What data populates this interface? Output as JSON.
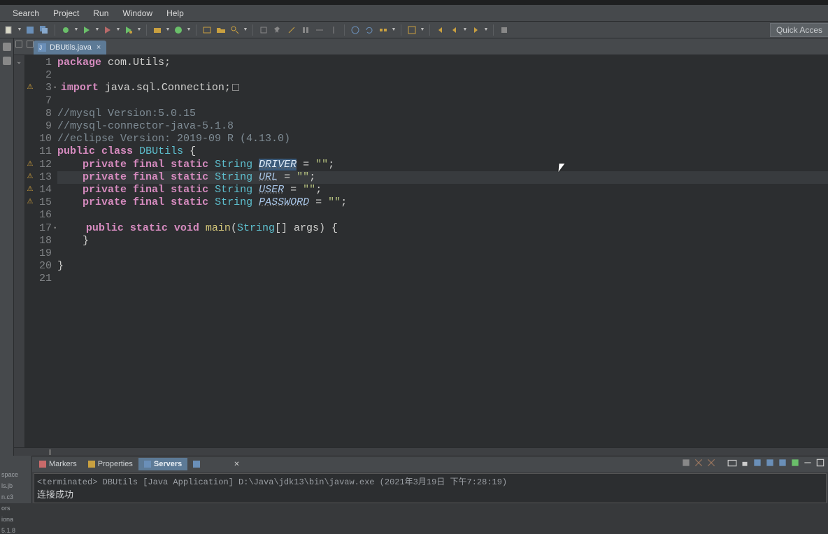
{
  "menubar": [
    "Search",
    "Project",
    "Run",
    "Window",
    "Help"
  ],
  "quick_access": "Quick Acces",
  "tab": {
    "name": "DBUtils.java"
  },
  "code_lines": [
    {
      "n": 1,
      "marker": "",
      "segs": [
        [
          "kw-pink",
          "package"
        ],
        [
          "plain",
          " "
        ],
        [
          "plain",
          "com.Utils;"
        ]
      ]
    },
    {
      "n": 2,
      "marker": "",
      "segs": []
    },
    {
      "n": 3,
      "marker": "warn",
      "bullet": true,
      "segs": [
        [
          "kw-pink",
          "import"
        ],
        [
          "plain",
          " "
        ],
        [
          "plain",
          "java.sql.Connection;"
        ],
        [
          "foldbox",
          ""
        ]
      ]
    },
    {
      "n": 7,
      "marker": "",
      "segs": []
    },
    {
      "n": 8,
      "marker": "",
      "segs": [
        [
          "comment",
          "//mysql Version:5.0.15"
        ]
      ]
    },
    {
      "n": 9,
      "marker": "",
      "segs": [
        [
          "comment",
          "//mysql-connector-java-5.1.8"
        ]
      ]
    },
    {
      "n": 10,
      "marker": "",
      "segs": [
        [
          "comment",
          "//eclipse Version: 2019-09 R (4.13.0)"
        ]
      ]
    },
    {
      "n": 11,
      "marker": "",
      "segs": [
        [
          "kw-pink",
          "public"
        ],
        [
          "plain",
          " "
        ],
        [
          "kw-pink",
          "class"
        ],
        [
          "plain",
          " "
        ],
        [
          "classname",
          "DBUtils"
        ],
        [
          "plain",
          " {"
        ]
      ]
    },
    {
      "n": 12,
      "marker": "warn",
      "segs": [
        [
          "plain",
          "    "
        ],
        [
          "kw-pink",
          "private"
        ],
        [
          "plain",
          " "
        ],
        [
          "kw-pink",
          "final"
        ],
        [
          "plain",
          " "
        ],
        [
          "kw-pink",
          "static"
        ],
        [
          "plain",
          " "
        ],
        [
          "type",
          "String"
        ],
        [
          "plain",
          " "
        ],
        [
          "field sel",
          "DRIVER"
        ],
        [
          "plain",
          " = "
        ],
        [
          "str",
          "\"\""
        ],
        [
          "plain",
          ";"
        ]
      ]
    },
    {
      "n": 13,
      "marker": "warn",
      "hl": true,
      "segs": [
        [
          "plain",
          "    "
        ],
        [
          "kw-pink",
          "private"
        ],
        [
          "plain",
          " "
        ],
        [
          "kw-pink",
          "final"
        ],
        [
          "plain",
          " "
        ],
        [
          "kw-pink",
          "static"
        ],
        [
          "plain",
          " "
        ],
        [
          "type",
          "String"
        ],
        [
          "plain",
          " "
        ],
        [
          "field",
          "URL"
        ],
        [
          "plain",
          " = "
        ],
        [
          "str",
          "\"\""
        ],
        [
          "plain",
          ";"
        ]
      ]
    },
    {
      "n": 14,
      "marker": "warn",
      "segs": [
        [
          "plain",
          "    "
        ],
        [
          "kw-pink",
          "private"
        ],
        [
          "plain",
          " "
        ],
        [
          "kw-pink",
          "final"
        ],
        [
          "plain",
          " "
        ],
        [
          "kw-pink",
          "static"
        ],
        [
          "plain",
          " "
        ],
        [
          "type",
          "String"
        ],
        [
          "plain",
          " "
        ],
        [
          "field",
          "USER"
        ],
        [
          "plain",
          " = "
        ],
        [
          "str",
          "\"\""
        ],
        [
          "plain",
          ";"
        ]
      ]
    },
    {
      "n": 15,
      "marker": "warn",
      "segs": [
        [
          "plain",
          "    "
        ],
        [
          "kw-pink",
          "private"
        ],
        [
          "plain",
          " "
        ],
        [
          "kw-pink",
          "final"
        ],
        [
          "plain",
          " "
        ],
        [
          "kw-pink",
          "static"
        ],
        [
          "plain",
          " "
        ],
        [
          "type",
          "String"
        ],
        [
          "plain",
          " "
        ],
        [
          "field",
          "PASSWORD"
        ],
        [
          "plain",
          " = "
        ],
        [
          "str",
          "\"\""
        ],
        [
          "plain",
          ";"
        ]
      ]
    },
    {
      "n": 16,
      "marker": "",
      "segs": []
    },
    {
      "n": 17,
      "marker": "",
      "bullet": true,
      "segs": [
        [
          "plain",
          "    "
        ],
        [
          "kw-pink",
          "public"
        ],
        [
          "plain",
          " "
        ],
        [
          "kw-pink",
          "static"
        ],
        [
          "plain",
          " "
        ],
        [
          "kw-pink",
          "void"
        ],
        [
          "plain",
          " "
        ],
        [
          "method",
          "main"
        ],
        [
          "plain",
          "("
        ],
        [
          "type",
          "String"
        ],
        [
          "plain",
          "[] "
        ],
        [
          "plain",
          "args"
        ],
        [
          "plain",
          ") {"
        ]
      ]
    },
    {
      "n": 18,
      "marker": "",
      "segs": [
        [
          "plain",
          "    }"
        ]
      ]
    },
    {
      "n": 19,
      "marker": "",
      "segs": []
    },
    {
      "n": 20,
      "marker": "",
      "segs": [
        [
          "plain",
          "}"
        ]
      ]
    },
    {
      "n": 21,
      "marker": "",
      "segs": []
    }
  ],
  "bottom_tabs": [
    {
      "label": "Markers",
      "active": false
    },
    {
      "label": "Properties",
      "active": false
    },
    {
      "label": "Servers",
      "active": true
    }
  ],
  "console": {
    "info": "<terminated> DBUtils [Java Application] D:\\Java\\jdk13\\bin\\javaw.exe (2021年3月19日 下午7:28:19)",
    "out": "连接成功"
  },
  "left_strip": [
    "space",
    "ls.jb",
    "n.c3",
    "ors",
    "iona",
    "5.1.8"
  ]
}
